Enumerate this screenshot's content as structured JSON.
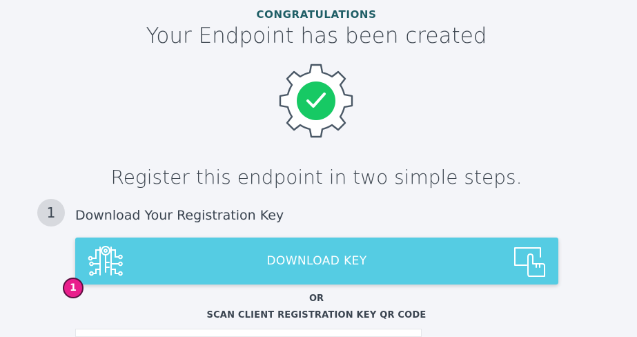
{
  "header": {
    "congrats": "CONGRATULATIONS",
    "headline": "Your Endpoint has been created"
  },
  "status_icon": {
    "outer": "gear-icon",
    "inner": "checkmark-icon",
    "accent_color": "#17c964"
  },
  "register": {
    "subhead": "Register this endpoint in two simple steps."
  },
  "step1": {
    "number": "1",
    "label": "Download Your Registration Key",
    "button_label": "DOWNLOAD KEY",
    "button_color": "#55cce3",
    "left_icon": "key-circuit-icon",
    "right_icon": "click-hand-icon"
  },
  "annotation_badge": {
    "number": "1",
    "color": "#e91e8c"
  },
  "alternative": {
    "or": "OR",
    "scan": "SCAN CLIENT REGISTRATION KEY QR CODE"
  }
}
